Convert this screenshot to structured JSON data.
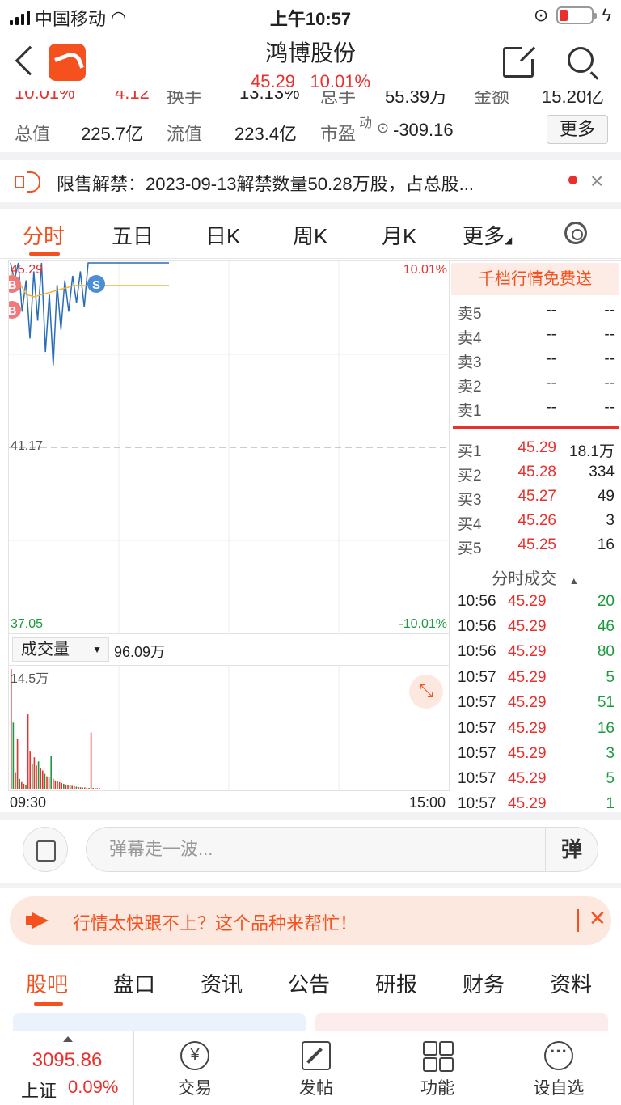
{
  "status_bar": {
    "carrier": "中国移动",
    "time": "上午10:57"
  },
  "header": {
    "stock_name": "鸿博股份",
    "price": "45.29",
    "change_pct": "10.01%"
  },
  "stats": {
    "row1_partial": [
      "10.01%",
      "4.12",
      "换手",
      "13.13%",
      "总手",
      "55.39万",
      "金额",
      "15.20亿"
    ],
    "row2": {
      "total_value_label": "总值",
      "total_value": "225.7亿",
      "float_value_label": "流值",
      "float_value": "223.4亿",
      "pe_label": "市盈",
      "pe_sup": "动",
      "pe_value": "-309.16",
      "more_label": "更多"
    }
  },
  "notice": {
    "text": "限售解禁：2023-09-13解禁数量50.28万股，占总股..."
  },
  "chart_tabs": [
    "分时",
    "五日",
    "日K",
    "周K",
    "月K",
    "更多"
  ],
  "chart_data": {
    "type": "line",
    "y_labels": {
      "top": "45.29",
      "mid": "41.17",
      "bottom": "37.05"
    },
    "pct_labels": {
      "top": "10.01%",
      "bottom": "-10.01%"
    },
    "ylim": [
      37.05,
      45.29
    ],
    "price_series": [
      45.29,
      44.9,
      45.29,
      44.2,
      44.9,
      43.6,
      45.1,
      44.0,
      45.29,
      43.3,
      44.6,
      43.0,
      44.8,
      43.8,
      44.9,
      44.2,
      45.0,
      44.4,
      45.1,
      44.3,
      45.29,
      45.29,
      45.29
    ],
    "avg_series": [
      45.29,
      45.1,
      44.8,
      44.75,
      44.8,
      44.85,
      44.9,
      44.95,
      45.0,
      45.0,
      45.0,
      45.0,
      45.0
    ],
    "markers": [
      "B",
      "B",
      "S"
    ],
    "volume_label": "成交量",
    "volume_total": "96.09万",
    "volume_max_label": "14.5万",
    "volume_max": 145000,
    "volume_series": [
      145000,
      80000,
      20000,
      60000,
      12000,
      8000,
      6000,
      5000,
      90000,
      45000,
      30000,
      38000,
      28000,
      33000,
      25000,
      22000,
      18000,
      15000,
      14000,
      40000,
      12000,
      10000,
      9000,
      8000,
      7000,
      6000,
      5000,
      4500,
      4000,
      3500,
      3000,
      2500,
      2000,
      1800,
      1500,
      1500,
      1200,
      1000,
      68000,
      1000,
      900,
      800,
      700
    ],
    "time_start": "09:30",
    "time_end": "15:00"
  },
  "order_book": {
    "banner": "千档行情免费送",
    "asks": [
      {
        "label": "卖5",
        "price": "--",
        "vol": "--"
      },
      {
        "label": "卖4",
        "price": "--",
        "vol": "--"
      },
      {
        "label": "卖3",
        "price": "--",
        "vol": "--"
      },
      {
        "label": "卖2",
        "price": "--",
        "vol": "--"
      },
      {
        "label": "卖1",
        "price": "--",
        "vol": "--"
      }
    ],
    "bids": [
      {
        "label": "买1",
        "price": "45.29",
        "vol": "18.1万"
      },
      {
        "label": "买2",
        "price": "45.28",
        "vol": "334"
      },
      {
        "label": "买3",
        "price": "45.27",
        "vol": "49"
      },
      {
        "label": "买4",
        "price": "45.26",
        "vol": "3"
      },
      {
        "label": "买5",
        "price": "45.25",
        "vol": "16"
      }
    ]
  },
  "ticks": {
    "title": "分时成交",
    "rows": [
      {
        "time": "10:56",
        "price": "45.29",
        "vol": "20"
      },
      {
        "time": "10:56",
        "price": "45.29",
        "vol": "46"
      },
      {
        "time": "10:56",
        "price": "45.29",
        "vol": "80"
      },
      {
        "time": "10:57",
        "price": "45.29",
        "vol": "5"
      },
      {
        "time": "10:57",
        "price": "45.29",
        "vol": "51"
      },
      {
        "time": "10:57",
        "price": "45.29",
        "vol": "16"
      },
      {
        "time": "10:57",
        "price": "45.29",
        "vol": "3"
      },
      {
        "time": "10:57",
        "price": "45.29",
        "vol": "5"
      },
      {
        "time": "10:57",
        "price": "45.29",
        "vol": "1"
      }
    ]
  },
  "danmaku": {
    "placeholder": "弹幕走一波...",
    "button": "弹"
  },
  "promo": {
    "text": "行情太快跟不上？这个品种来帮忙！"
  },
  "bottom_tabs": [
    "股吧",
    "盘口",
    "资讯",
    "公告",
    "研报",
    "财务",
    "资料"
  ],
  "bottom_nav": {
    "index_value": "3095.86",
    "index_name": "上证",
    "index_pct": "0.09%",
    "items": [
      "交易",
      "发帖",
      "功能",
      "设自选"
    ]
  },
  "colors": {
    "accent": "#f4511e",
    "up": "#e8312f",
    "down": "#1a9a3a",
    "price_line": "#2a6db5",
    "avg_line": "#f2b233"
  }
}
